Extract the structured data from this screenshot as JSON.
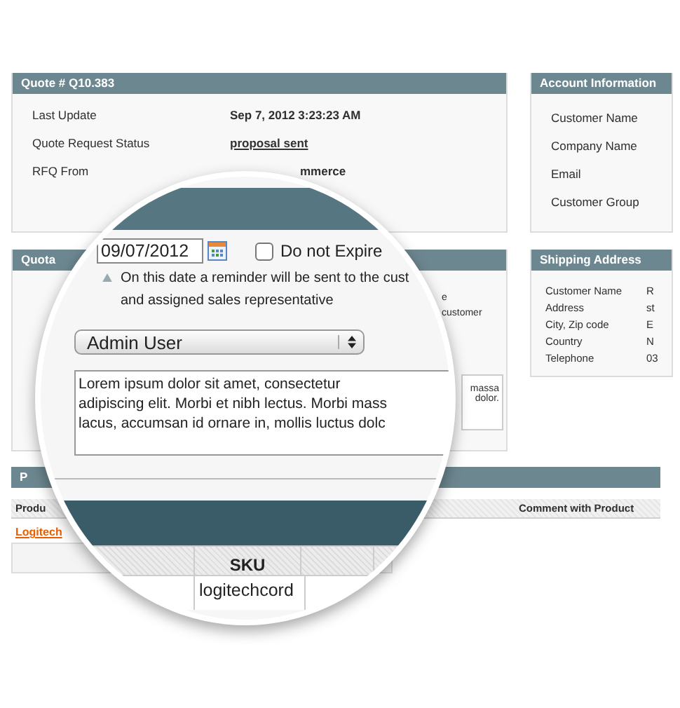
{
  "quote_panel": {
    "title": "Quote # Q10.383",
    "rows": [
      {
        "label": "Last Update",
        "value": "Sep 7, 2012 3:23:23 AM",
        "kind": "text"
      },
      {
        "label": "Quote Request Status",
        "value": "proposal sent",
        "kind": "link"
      },
      {
        "label": "RFQ From",
        "value": "mmerce",
        "kind": "text"
      }
    ]
  },
  "account_panel": {
    "title": "Account Information",
    "labels": [
      "Customer Name",
      "Company Name",
      "Email",
      "Customer Group"
    ]
  },
  "quotation_panel": {
    "title": "Quota",
    "fragments": [
      "e",
      "customer"
    ],
    "note_fragments": [
      "massa",
      "dolor."
    ]
  },
  "shipping_panel": {
    "title": "Shipping Address",
    "rows": [
      {
        "label": "Customer Name",
        "value": "R"
      },
      {
        "label": "Address",
        "value": "st"
      },
      {
        "label": "City, Zip code",
        "value": "E"
      },
      {
        "label": "Country",
        "value": "N"
      },
      {
        "label": "Telephone",
        "value": "03"
      }
    ]
  },
  "products_panel": {
    "title": "P",
    "columns": [
      "Produ",
      "Comment with Product"
    ],
    "product_link": "Logitech"
  },
  "magnifier": {
    "expiry_date": "09/07/2012",
    "do_not_expire": {
      "label": "Do not Expire",
      "checked": false
    },
    "hint_lines": [
      "On this date a reminder will be sent to the cust",
      "and assigned sales representative"
    ],
    "assignee": "Admin User",
    "comment_lines": [
      "Lorem ipsum dolor sit amet, consectetur",
      "adipiscing elit. Morbi et nibh lectus. Morbi mass",
      "lacus, accumsan id ornare in, mollis luctus dolc"
    ],
    "table": {
      "columns": [
        "SKU"
      ],
      "rows": [
        [
          "logitechcord"
        ]
      ]
    }
  }
}
